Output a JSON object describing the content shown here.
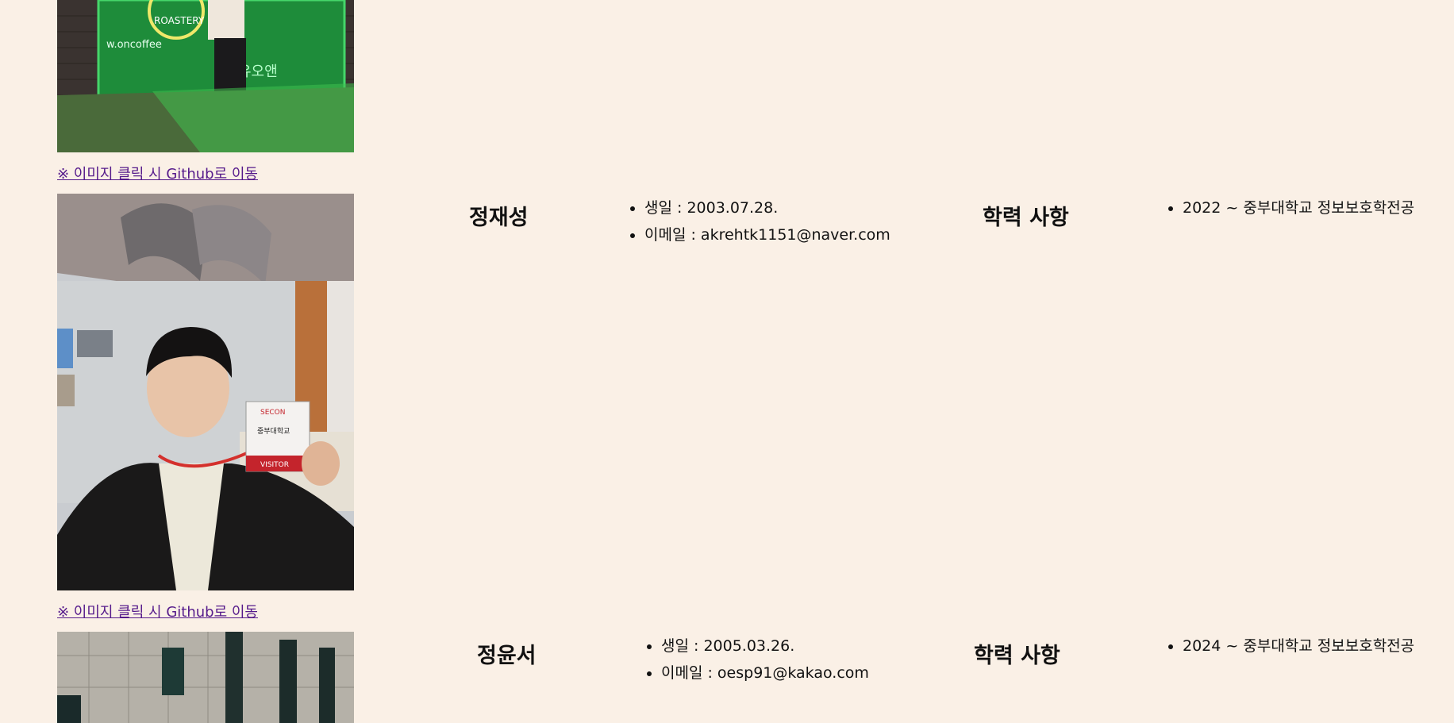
{
  "members": [
    {
      "photo_alt": "",
      "link_label": "※ 이미지 클릭 시 Github로 이동"
    },
    {
      "name": "정재성",
      "info": [
        "생일 : 2003.07.28.",
        "이메일 : akrehtk1151@naver.com"
      ],
      "education_title": "학력 사항",
      "education": [
        "2022 ~ 중부대학교 정보보호학전공"
      ],
      "link_label": "※ 이미지 클릭 시 Github로 이동"
    },
    {
      "name": "정윤서",
      "info": [
        "생일 : 2005.03.26.",
        "이메일 : oesp91@kakao.com"
      ],
      "education_title": "학력 사항",
      "education": [
        "2024 ~ 중부대학교 정보보호학전공"
      ]
    }
  ],
  "photo1_sign": {
    "brand": "ROASTERY",
    "handle": "w.oncoffee",
    "korean": "유오앤"
  },
  "photo2_badge": {
    "logo": "SECON",
    "school": "중부대학교",
    "visitor": "VISITOR"
  },
  "colors": {
    "background": "#faf0e6",
    "link": "#551a8b"
  }
}
